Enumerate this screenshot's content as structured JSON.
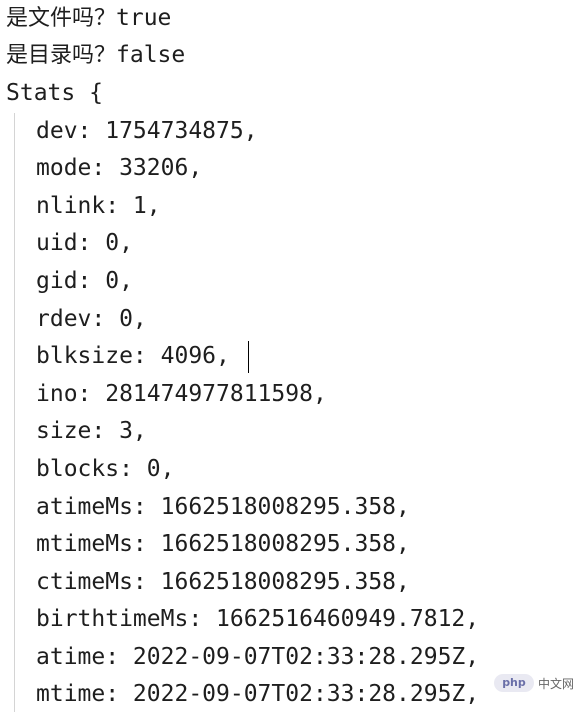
{
  "console": {
    "lines": [
      {
        "prefix": "是文件吗？",
        "value": "true"
      },
      {
        "prefix": "是目录吗？",
        "value": "false"
      },
      {
        "text": "Stats {"
      },
      {
        "text": "dev: 1754734875,"
      },
      {
        "text": "mode: 33206,"
      },
      {
        "text": "nlink: 1,"
      },
      {
        "text": "uid: 0,"
      },
      {
        "text": "gid: 0,"
      },
      {
        "text": "rdev: 0,"
      },
      {
        "text": "blksize: 4096,"
      },
      {
        "text": "ino: 281474977811598,"
      },
      {
        "text": "size: 3,"
      },
      {
        "text": "blocks: 0,"
      },
      {
        "text": "atimeMs: 1662518008295.358,"
      },
      {
        "text": "mtimeMs: 1662518008295.358,"
      },
      {
        "text": "ctimeMs: 1662518008295.358,"
      },
      {
        "text": "birthtimeMs: 1662516460949.7812,"
      },
      {
        "text": "atime: 2022-09-07T02:33:28.295Z,"
      },
      {
        "text": "mtime: 2022-09-07T02:33:28.295Z,"
      }
    ]
  },
  "watermark": {
    "logo": "php",
    "text": "中文网"
  }
}
